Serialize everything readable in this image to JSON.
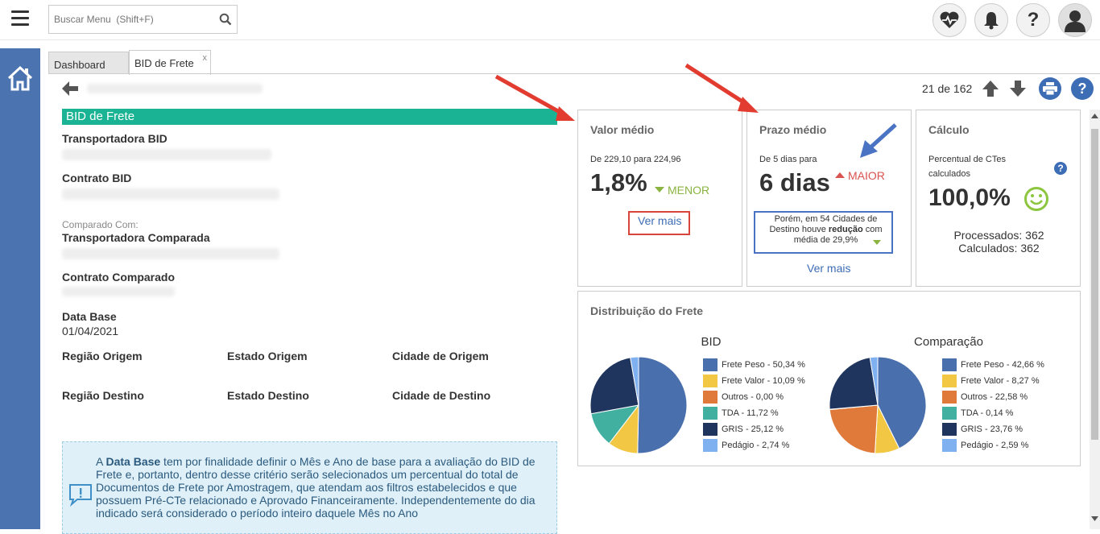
{
  "header": {
    "search_placeholder": "Buscar Menu  (Shift+F)",
    "icons": [
      "menu-icon",
      "search-icon",
      "heart-monitor-icon",
      "bell-icon",
      "help-icon",
      "user-icon"
    ]
  },
  "tabs": [
    {
      "label": "Dashboard"
    },
    {
      "label": "BID de Frete",
      "close": "x"
    }
  ],
  "pager": {
    "text": "21 de 162"
  },
  "form": {
    "section_title": "BID de Frete",
    "transportadora_bid": "Transportadora BID",
    "contrato_bid": "Contrato BID",
    "comparado_com": "Comparado Com:",
    "transportadora_comparada": "Transportadora Comparada",
    "contrato_comparado": "Contrato Comparado",
    "data_base_label": "Data Base",
    "data_base_value": "01/04/2021",
    "regiao_origem": "Região Origem",
    "estado_origem": "Estado Origem",
    "cidade_origem": "Cidade de Origem",
    "regiao_destino": "Região Destino",
    "estado_destino": "Estado Destino",
    "cidade_destino": "Cidade de Destino"
  },
  "info": {
    "prefix": "A ",
    "bold": "Data Base",
    "text": " tem por finalidade definir o Mês e Ano de base para a avaliação do BID de Frete e, portanto, dentro desse critério serão selecionados um percentual do total de Documentos de Frete por Amostragem, que atendam aos filtros estabelecidos e que possuem Pré-CTe relacionado e Aprovado Financeiramente. Independentemente do dia indicado será considerado o período inteiro daquele Mês no Ano"
  },
  "valor_medio": {
    "title": "Valor médio",
    "subtitle": "De 229,10 para 224,96",
    "value": "1,8%",
    "trend": "MENOR",
    "link": "Ver mais"
  },
  "prazo_medio": {
    "title": "Prazo médio",
    "subtitle": "De 5 dias para",
    "value": "6 dias",
    "trend": "MAIOR",
    "note_pre": "Porém, em 54 Cidades de Destino houve ",
    "note_bold": "redução",
    "note_post": " com média de 29,9%",
    "link": "Ver mais"
  },
  "calculo": {
    "title": "Cálculo",
    "subtitle": "Percentual de CTes calculados",
    "value": "100,0%",
    "processados": "Processados: 362",
    "calculados": "Calculados: 362"
  },
  "distribuicao": {
    "title": "Distribuição do Frete",
    "colors": [
      "#4a6fad",
      "#f2c744",
      "#e07a3a",
      "#41b0a0",
      "#1f355e",
      "#7fb0f0"
    ],
    "bid": {
      "title": "BID",
      "legend": [
        "Frete Peso - 50,34 %",
        "Frete Valor - 10,09 %",
        "Outros - 0,00 %",
        "TDA - 11,72 %",
        "GRIS - 25,12 %",
        "Pedágio - 2,74 %"
      ],
      "values": [
        50.34,
        10.09,
        0.0,
        11.72,
        25.12,
        2.74
      ]
    },
    "comparacao": {
      "title": "Comparação",
      "legend": [
        "Frete Peso - 42,66 %",
        "Frete Valor - 8,27 %",
        "Outros - 22,58 %",
        "TDA - 0,14 %",
        "GRIS - 23,76 %",
        "Pedágio - 2,59 %"
      ],
      "values": [
        42.66,
        8.27,
        22.58,
        0.14,
        23.76,
        2.59
      ]
    }
  }
}
